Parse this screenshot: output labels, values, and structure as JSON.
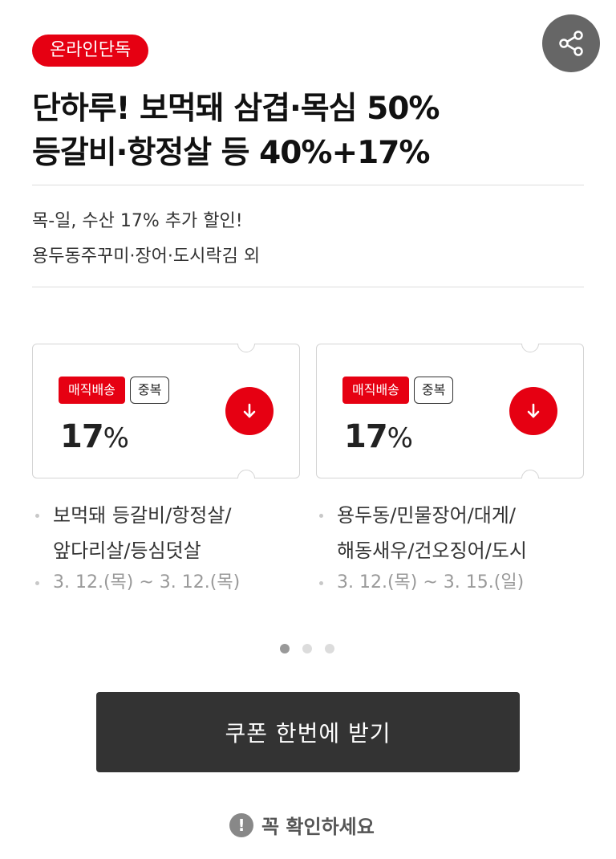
{
  "badge": "온라인단독",
  "title": {
    "line1": "단하루! 보먹돼 삼겹·목심 50%",
    "line2": "등갈비·항정살 등 40%+17%"
  },
  "subtitle": {
    "line1": "목-일, 수산 17% 추가 할인!",
    "line2": "용두동주꾸미·장어·도시락김 외"
  },
  "coupons": [
    {
      "tag_primary": "매직배송",
      "tag_secondary": "중복",
      "percent": "17",
      "percent_symbol": "%",
      "desc_line1": "보먹돼 등갈비/항정살/",
      "desc_line2": "앞다리살/등심덧살",
      "date": "3. 12.(목) ~ 3. 12.(목)"
    },
    {
      "tag_primary": "매직배송",
      "tag_secondary": "중복",
      "percent": "17",
      "percent_symbol": "%",
      "desc_line1": "용두동/민물장어/대게/",
      "desc_line2": "해동새우/건오징어/도시",
      "date": "3. 12.(목) ~ 3. 15.(일)"
    }
  ],
  "pagination": {
    "total": 3,
    "current": 1
  },
  "cta_label": "쿠폰 한번에 받기",
  "confirm_label": "꼭 확인하세요",
  "icons": {
    "share": "share-icon",
    "download": "download-arrow-icon",
    "info": "exclamation-icon"
  },
  "colors": {
    "accent": "#e60012",
    "button_dark": "#333333",
    "share_bg": "#666666"
  }
}
